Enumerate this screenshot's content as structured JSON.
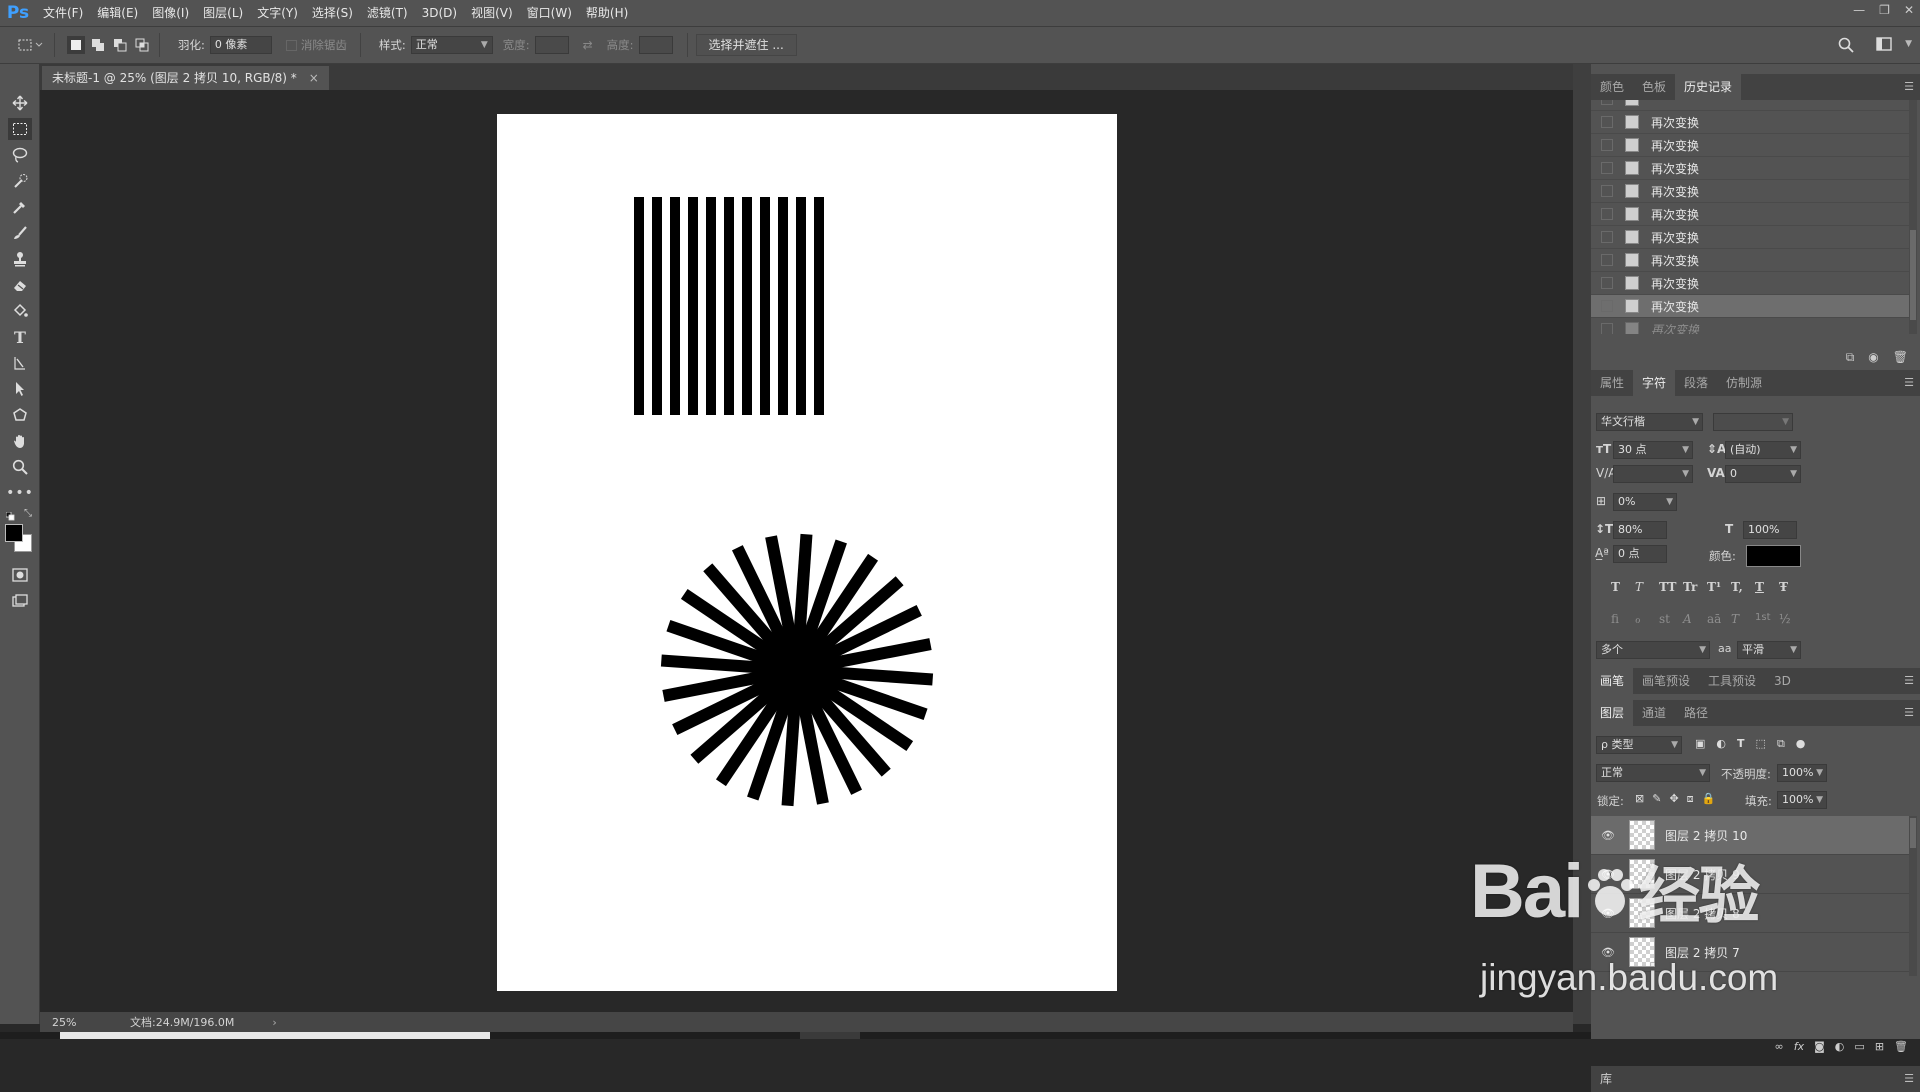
{
  "app": {
    "logo": "Ps"
  },
  "menu": [
    "文件(F)",
    "编辑(E)",
    "图像(I)",
    "图层(L)",
    "文字(Y)",
    "选择(S)",
    "滤镜(T)",
    "3D(D)",
    "视图(V)",
    "窗口(W)",
    "帮助(H)"
  ],
  "options": {
    "feather_label": "羽化:",
    "feather_value": "0 像素",
    "antialias_label": "消除锯齿",
    "style_label": "样式:",
    "style_value": "正常",
    "width_label": "宽度:",
    "height_label": "高度:",
    "select_mask_button": "选择并遮住 ..."
  },
  "document": {
    "tab_title": "未标题-1 @ 25% (图层 2 拷贝 10, RGB/8) *",
    "close": "×"
  },
  "status": {
    "zoom": "25%",
    "doc_info": "文档:24.9M/196.0M",
    "arrow": "›"
  },
  "history_panel": {
    "tabs": [
      "颜色",
      "色板",
      "历史记录"
    ],
    "active_tab": 2,
    "items": [
      "再次变换",
      "再次变换",
      "再次变换",
      "再次变换",
      "再次变换",
      "再次变换",
      "再次变换",
      "再次变换",
      "再次变换",
      "再次变换"
    ],
    "selected_index": 8,
    "ghost_index": 9
  },
  "character_panel": {
    "tabs": [
      "属性",
      "字符",
      "段落",
      "仿制源"
    ],
    "active_tab": 1,
    "font_family": "华文行楷",
    "font_size": "30 点",
    "leading": "(自动)",
    "kerning": "",
    "tracking": "0",
    "scale_pct": "0%",
    "vertical_scale": "80%",
    "horizontal_scale": "100%",
    "baseline_shift": "0 点",
    "color_label": "颜色:",
    "color_value": "#000000",
    "language": "多个",
    "aa_icon": "aa",
    "antialias": "平滑",
    "style_buttons": [
      "T",
      "T",
      "TT",
      "Tr",
      "T¹",
      "T,",
      "T",
      "Ŧ"
    ],
    "opentype_buttons": [
      "fi",
      "ℴ",
      "st",
      "A",
      "aā",
      "T",
      "1st",
      "½"
    ]
  },
  "brush_panel": {
    "tabs": [
      "画笔",
      "画笔预设",
      "工具预设",
      "3D"
    ],
    "active_tab": 0
  },
  "layers_panel": {
    "tabs": [
      "图层",
      "通道",
      "路径"
    ],
    "active_tab": 0,
    "filter_label": "ρ 类型",
    "blend_mode": "正常",
    "opacity_label": "不透明度:",
    "opacity_value": "100%",
    "lock_label": "锁定:",
    "fill_label": "填充:",
    "fill_value": "100%",
    "layers": [
      "图层 2 拷贝 10",
      "图层 2 拷贝 9",
      "图层 2 拷贝 8",
      "图层 2 拷贝 7"
    ],
    "selected_index": 0
  },
  "library_panel": {
    "label": "库"
  },
  "watermark": {
    "brand": "Bai",
    "brand_suffix": "经验",
    "url": "jingyan.baidu.com"
  }
}
